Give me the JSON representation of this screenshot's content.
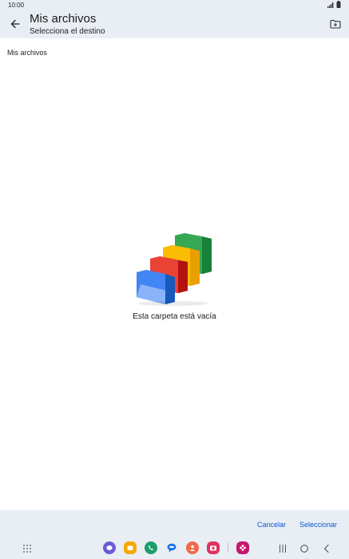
{
  "status_bar": {
    "time": "10:00"
  },
  "app_bar": {
    "title": "Mis archivos",
    "subtitle": "Selecciona el destino"
  },
  "breadcrumb": "Mis archivos",
  "empty_state": {
    "message": "Esta carpeta está vacía"
  },
  "actions": {
    "cancel_label": "Cancelar",
    "select_label": "Seleccionar"
  },
  "colors": {
    "accent": "#0b57d0",
    "chrome_background": "#e8eef4",
    "folder_blue": "#4285f4",
    "folder_red": "#ea4335",
    "folder_yellow": "#fbbc04",
    "folder_green": "#34a853"
  },
  "dock_icons": [
    "messages-icon",
    "files-icon",
    "phone-icon",
    "chat-icon",
    "contacts-icon",
    "camera-icon",
    "flower-app-icon"
  ],
  "nav_icons": [
    "apps-grid-icon",
    "recents-icon",
    "home-icon",
    "back-nav-icon"
  ]
}
